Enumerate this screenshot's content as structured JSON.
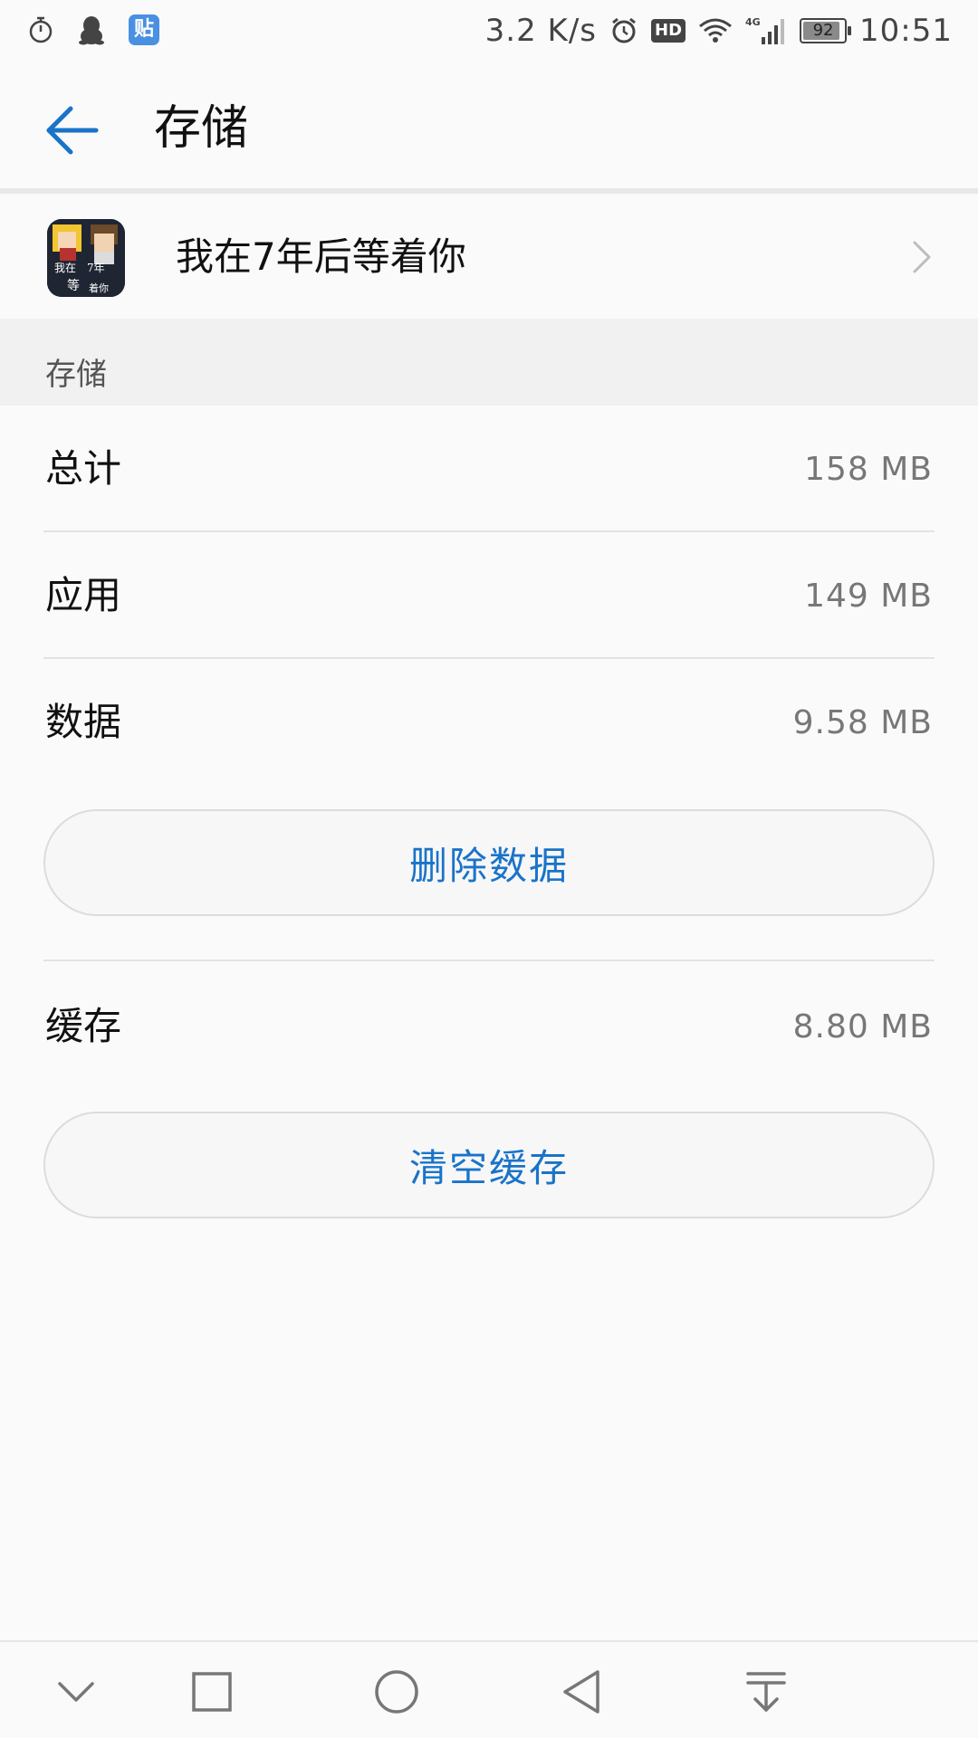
{
  "status_bar": {
    "network_speed": "3.2 K/s",
    "hd_label": "HD",
    "network_type": "4G",
    "battery_level": "92",
    "battery_fraction": 0.92,
    "time": "10:51",
    "tieba_label": "贴",
    "left_icons": [
      "stopwatch-icon",
      "qq-penguin-icon",
      "tieba-icon"
    ],
    "right_icons": [
      "alarm-icon",
      "hd-icon",
      "wifi-icon",
      "signal-icon",
      "battery-icon"
    ]
  },
  "header": {
    "title": "存储",
    "back_icon": "arrow-left-icon"
  },
  "app": {
    "name": "我在7年后等着你",
    "icon_text_1": "我在",
    "icon_text_2": "7年",
    "icon_text_3": "等",
    "icon_text_4": "着你"
  },
  "section": {
    "title": "存储"
  },
  "rows": [
    {
      "label": "总计",
      "value": "158 MB"
    },
    {
      "label": "应用",
      "value": "149 MB"
    },
    {
      "label": "数据",
      "value": "9.58 MB"
    }
  ],
  "delete_data_button": {
    "label": "删除数据"
  },
  "cache_row": {
    "label": "缓存",
    "value": "8.80 MB"
  },
  "clear_cache_button": {
    "label": "清空缓存"
  },
  "nav_bar": {
    "icons": [
      "chevron-down-icon",
      "recents-square-icon",
      "home-circle-icon",
      "back-triangle-icon",
      "notification-pull-icon"
    ]
  },
  "colors": {
    "accent": "#1a73c9",
    "background": "#fafafa",
    "section_background": "#f1f1f1",
    "divider": "#e3e3e3"
  }
}
